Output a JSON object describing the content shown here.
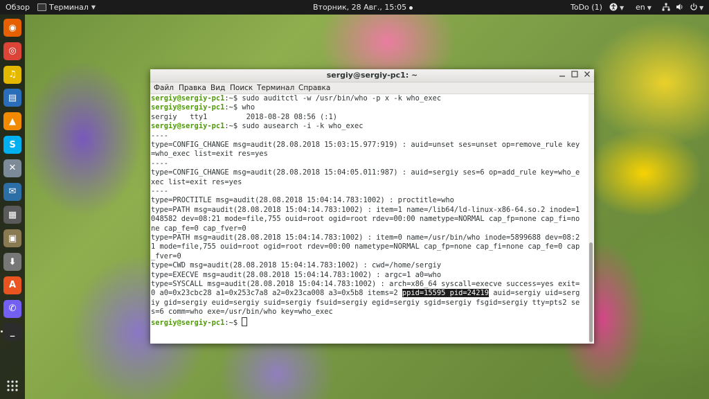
{
  "topbar": {
    "activities": "Обзор",
    "app_name": "Терминал",
    "clock": "Вторник, 28 Авг., 15:05",
    "todo": "ToDo (1)",
    "lang": "en"
  },
  "dock": {
    "items": [
      {
        "name": "firefox-icon",
        "color": "#e66000"
      },
      {
        "name": "chrome-icon",
        "color": "#db4437"
      },
      {
        "name": "rhythmbox-icon",
        "color": "#e5b800"
      },
      {
        "name": "libreoffice-writer-icon",
        "color": "#2a6ebb"
      },
      {
        "name": "vlc-icon",
        "color": "#f28a00"
      },
      {
        "name": "skype-icon",
        "color": "#00aff0"
      },
      {
        "name": "settings-tools-icon",
        "color": "#7d8b99"
      },
      {
        "name": "thunderbird-icon",
        "color": "#2c6ea6"
      },
      {
        "name": "calculator-icon",
        "color": "#5a5a5a"
      },
      {
        "name": "image-viewer-icon",
        "color": "#8a7a52"
      },
      {
        "name": "downloader-icon",
        "color": "#777777"
      },
      {
        "name": "software-center-icon",
        "color": "#e95420"
      },
      {
        "name": "viber-icon",
        "color": "#7360f2"
      },
      {
        "name": "terminal-icon",
        "color": "#2c2c2c"
      }
    ]
  },
  "window": {
    "title": "sergiy@sergiy-pc1: ~",
    "menu": [
      "Файл",
      "Правка",
      "Вид",
      "Поиск",
      "Терминал",
      "Справка"
    ]
  },
  "terminal": {
    "prompt": "sergiy@sergiy-pc1",
    "lines": [
      {
        "p": true,
        "t": ":~$ sudo auditctl -w /usr/bin/who -p x -k who_exec"
      },
      {
        "p": true,
        "t": ":~$ who"
      },
      {
        "p": false,
        "t": "sergiy   tty1         2018-08-28 08:56 (:1)"
      },
      {
        "p": true,
        "t": ":~$ sudo ausearch -i -k who_exec"
      },
      {
        "p": false,
        "t": "----"
      },
      {
        "p": false,
        "t": "type=CONFIG_CHANGE msg=audit(28.08.2018 15:03:15.977:919) : auid=unset ses=unset op=remove_rule key"
      },
      {
        "p": false,
        "t": "=who_exec list=exit res=yes"
      },
      {
        "p": false,
        "t": "----"
      },
      {
        "p": false,
        "t": "type=CONFIG_CHANGE msg=audit(28.08.2018 15:04:05.011:987) : auid=sergiy ses=6 op=add_rule key=who_e"
      },
      {
        "p": false,
        "t": "xec list=exit res=yes"
      },
      {
        "p": false,
        "t": "----"
      },
      {
        "p": false,
        "t": "type=PROCTITLE msg=audit(28.08.2018 15:04:14.783:1002) : proctitle=who"
      },
      {
        "p": false,
        "t": "type=PATH msg=audit(28.08.2018 15:04:14.783:1002) : item=1 name=/lib64/ld-linux-x86-64.so.2 inode=1"
      },
      {
        "p": false,
        "t": "048582 dev=08:21 mode=file,755 ouid=root ogid=root rdev=00:00 nametype=NORMAL cap_fp=none cap_fi=no"
      },
      {
        "p": false,
        "t": "ne cap_fe=0 cap_fver=0"
      },
      {
        "p": false,
        "t": "type=PATH msg=audit(28.08.2018 15:04:14.783:1002) : item=0 name=/usr/bin/who inode=5899688 dev=08:2"
      },
      {
        "p": false,
        "t": "1 mode=file,755 ouid=root ogid=root rdev=00:00 nametype=NORMAL cap_fp=none cap_fi=none cap_fe=0 cap"
      },
      {
        "p": false,
        "t": "_fver=0"
      },
      {
        "p": false,
        "t": "type=CWD msg=audit(28.08.2018 15:04:14.783:1002) : cwd=/home/sergiy"
      },
      {
        "p": false,
        "t": "type=EXECVE msg=audit(28.08.2018 15:04:14.783:1002) : argc=1 a0=who"
      },
      {
        "p": false,
        "t": "type=SYSCALL msg=audit(28.08.2018 15:04:14.783:1002) : arch=x86_64 syscall=execve success=yes exit="
      },
      {
        "p": false,
        "t": "0 a0=0x23cbc28 a1=0x253c7a8 a2=0x23ca008 a3=0x5b8 items=2 ",
        "h": "ppid=15595 pid=24219",
        "a": " auid=sergiy uid=serg"
      },
      {
        "p": false,
        "t": "iy gid=sergiy euid=sergiy suid=sergiy fsuid=sergiy egid=sergiy sgid=sergiy fsgid=sergiy tty=pts2 se"
      },
      {
        "p": false,
        "t": "s=6 comm=who exe=/usr/bin/who key=who_exec"
      },
      {
        "p": true,
        "t": ":~$ ",
        "cursor": true
      }
    ]
  }
}
